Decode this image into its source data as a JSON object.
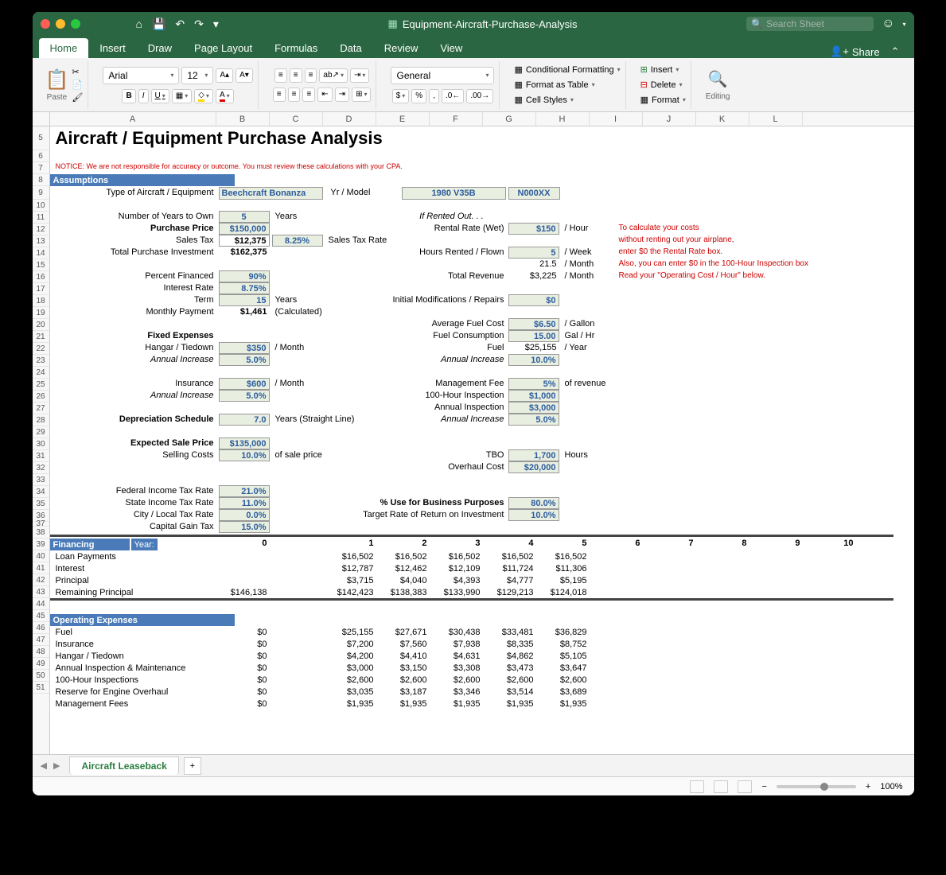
{
  "titlebar": {
    "title": "Equipment-Aircraft-Purchase-Analysis",
    "searchPlaceholder": "Search Sheet"
  },
  "tabs": [
    "Home",
    "Insert",
    "Draw",
    "Page Layout",
    "Formulas",
    "Data",
    "Review",
    "View"
  ],
  "share": "Share",
  "ribbon": {
    "paste": "Paste",
    "font": "Arial",
    "size": "12",
    "numfmt": "General",
    "condfmt": "Conditional Formatting",
    "table": "Format as Table",
    "cellstyles": "Cell Styles",
    "insert": "Insert",
    "delete": "Delete",
    "format": "Format",
    "editing": "Editing"
  },
  "cols": [
    "A",
    "B",
    "C",
    "D",
    "E",
    "F",
    "G",
    "H",
    "I",
    "J",
    "K",
    "L"
  ],
  "rows": [
    5,
    6,
    7,
    8,
    9,
    10,
    11,
    12,
    13,
    14,
    15,
    16,
    17,
    18,
    19,
    20,
    21,
    22,
    23,
    24,
    25,
    26,
    27,
    28,
    29,
    30,
    31,
    32,
    33,
    34,
    35,
    36,
    37,
    38,
    39,
    40,
    41,
    42,
    43,
    44,
    45,
    46,
    47,
    48,
    49,
    50,
    51
  ],
  "t": {
    "title": "Aircraft / Equipment Purchase Analysis",
    "notice": "NOTICE: We are not responsible for accuracy or outcome. You must review these calculations with your CPA.",
    "assumptions": "Assumptions",
    "typeLabel": "Type of Aircraft  / Equipment",
    "type": "Beechcraft Bonanza",
    "yrModelLabel": "Yr / Model",
    "yrModel": "1980 V35B",
    "reg": "N000XX",
    "yearsOwnLabel": "Number of Years to Own",
    "yearsOwn": "5",
    "years": "Years",
    "ifRented": "If Rented Out. . .",
    "purchaseLabel": "Purchase Price",
    "purchase": "$150,000",
    "rentalRateLabel": "Rental Rate (Wet)",
    "rentalRate": "$150",
    "perHour": "/ Hour",
    "salesTaxLabel": "Sales Tax",
    "salesTax": "$12,375",
    "salesTaxRate": "8.25%",
    "salesTaxRateLabel": "Sales Tax Rate",
    "totalInvestLabel": "Total Purchase Investment",
    "totalInvest": "$162,375",
    "hoursRentedLabel": "Hours Rented / Flown",
    "hoursRented": "5",
    "perWeek": "/ Week",
    "perMonthFlown": "21.5",
    "perMonth": "/ Month",
    "pctFinLabel": "Percent Financed",
    "pctFin": "90%",
    "totRevLabel": "Total Revenue",
    "totRev": "$3,225",
    "intRateLabel": "Interest Rate",
    "intRate": "8.75%",
    "termLabel": "Term",
    "term": "15",
    "initModLabel": "Initial Modifications / Repairs",
    "initMod": "$0",
    "monPayLabel": "Monthly Payment",
    "monPay": "$1,461",
    "calc": "(Calculated)",
    "avgFuelLabel": "Average Fuel Cost",
    "avgFuel": "$6.50",
    "perGal": "/ Gallon",
    "fixedExp": "Fixed Expenses",
    "fuelConsLabel": "Fuel Consumption",
    "fuelCons": "15.00",
    "galHr": "Gal / Hr",
    "hangarLabel": "Hangar / Tiedown",
    "hangar": "$350",
    "fuelLabel": "Fuel",
    "fuelYear": "$25,155",
    "perYear": "/ Year",
    "annInc": "Annual Increase",
    "annIncVal": "5.0%",
    "fuelInc": "10.0%",
    "insLabel": "Insurance",
    "ins": "$600",
    "mgmtFeeLabel": "Management Fee",
    "mgmtFee": "5%",
    "ofRev": "of revenue",
    "insp100Label": "100-Hour Inspection",
    "insp100": "$1,000",
    "annInspLabel": "Annual Inspection",
    "annInsp": "$3,000",
    "depLabel": "Depreciation Schedule",
    "dep": "7.0",
    "depUnit": "Years  (Straight Line)",
    "inspInc": "5.0%",
    "salePriceLabel": "Expected Sale Price",
    "salePrice": "$135,000",
    "sellCostLabel": "Selling Costs",
    "sellCost": "10.0%",
    "ofSale": "of sale price",
    "tboLabel": "TBO",
    "tbo": "1,700",
    "hours": "Hours",
    "overhaulLabel": "Overhaul Cost",
    "overhaul": "$20,000",
    "fedTaxLabel": "Federal  Income Tax Rate",
    "fedTax": "21.0%",
    "stateTaxLabel": "State Income Tax Rate",
    "stateTax": "11.0%",
    "pctBizLabel": "% Use for Business Purposes",
    "pctBiz": "80.0%",
    "cityTaxLabel": "City / Local Tax Rate",
    "cityTax": "0.0%",
    "rorLabel": "Target Rate of Return on Investment",
    "ror": "10.0%",
    "capGainLabel": "Capital Gain Tax",
    "capGain": "15.0%",
    "financing": "Financing",
    "yearHdr": "Year:",
    "yearVals": [
      "0",
      "1",
      "2",
      "3",
      "4",
      "5",
      "6",
      "7",
      "8",
      "9",
      "10"
    ],
    "loanPay": "Loan Payments",
    "loanPayVals": [
      "",
      "$16,502",
      "$16,502",
      "$16,502",
      "$16,502",
      "$16,502"
    ],
    "interest": "Interest",
    "interestVals": [
      "",
      "$12,787",
      "$12,462",
      "$12,109",
      "$11,724",
      "$11,306"
    ],
    "principal": "Principal",
    "principalVals": [
      "",
      "$3,715",
      "$4,040",
      "$4,393",
      "$4,777",
      "$5,195"
    ],
    "remPrin": "Remaining Principal",
    "remPrinVals": [
      "$146,138",
      "$142,423",
      "$138,383",
      "$133,990",
      "$129,213",
      "$124,018"
    ],
    "opExp": "Operating Expenses",
    "oe1": "Fuel",
    "oe1v": [
      "$0",
      "$25,155",
      "$27,671",
      "$30,438",
      "$33,481",
      "$36,829"
    ],
    "oe2": "Insurance",
    "oe2v": [
      "$0",
      "$7,200",
      "$7,560",
      "$7,938",
      "$8,335",
      "$8,752"
    ],
    "oe3": "Hangar / Tiedown",
    "oe3v": [
      "$0",
      "$4,200",
      "$4,410",
      "$4,631",
      "$4,862",
      "$5,105"
    ],
    "oe4": "Annual Inspection & Maintenance",
    "oe4v": [
      "$0",
      "$3,000",
      "$3,150",
      "$3,308",
      "$3,473",
      "$3,647"
    ],
    "oe5": "100-Hour Inspections",
    "oe5v": [
      "$0",
      "$2,600",
      "$2,600",
      "$2,600",
      "$2,600",
      "$2,600"
    ],
    "oe6": "Reserve for Engine Overhaul",
    "oe6v": [
      "$0",
      "$3,035",
      "$3,187",
      "$3,346",
      "$3,514",
      "$3,689"
    ],
    "oe7": "Management Fees",
    "oe7v": [
      "$0",
      "$1,935",
      "$1,935",
      "$1,935",
      "$1,935",
      "$1,935"
    ],
    "help1": "To calculate your costs",
    "help2": "without renting out your airplane,",
    "help3": "enter $0 the Rental Rate box.",
    "help4": "Also, you can enter $0 in the 100-Hour Inspection box",
    "help5": "Read your \"Operating Cost / Hour\" below."
  },
  "sheettab": "Aircraft Leaseback",
  "zoom": "100%"
}
